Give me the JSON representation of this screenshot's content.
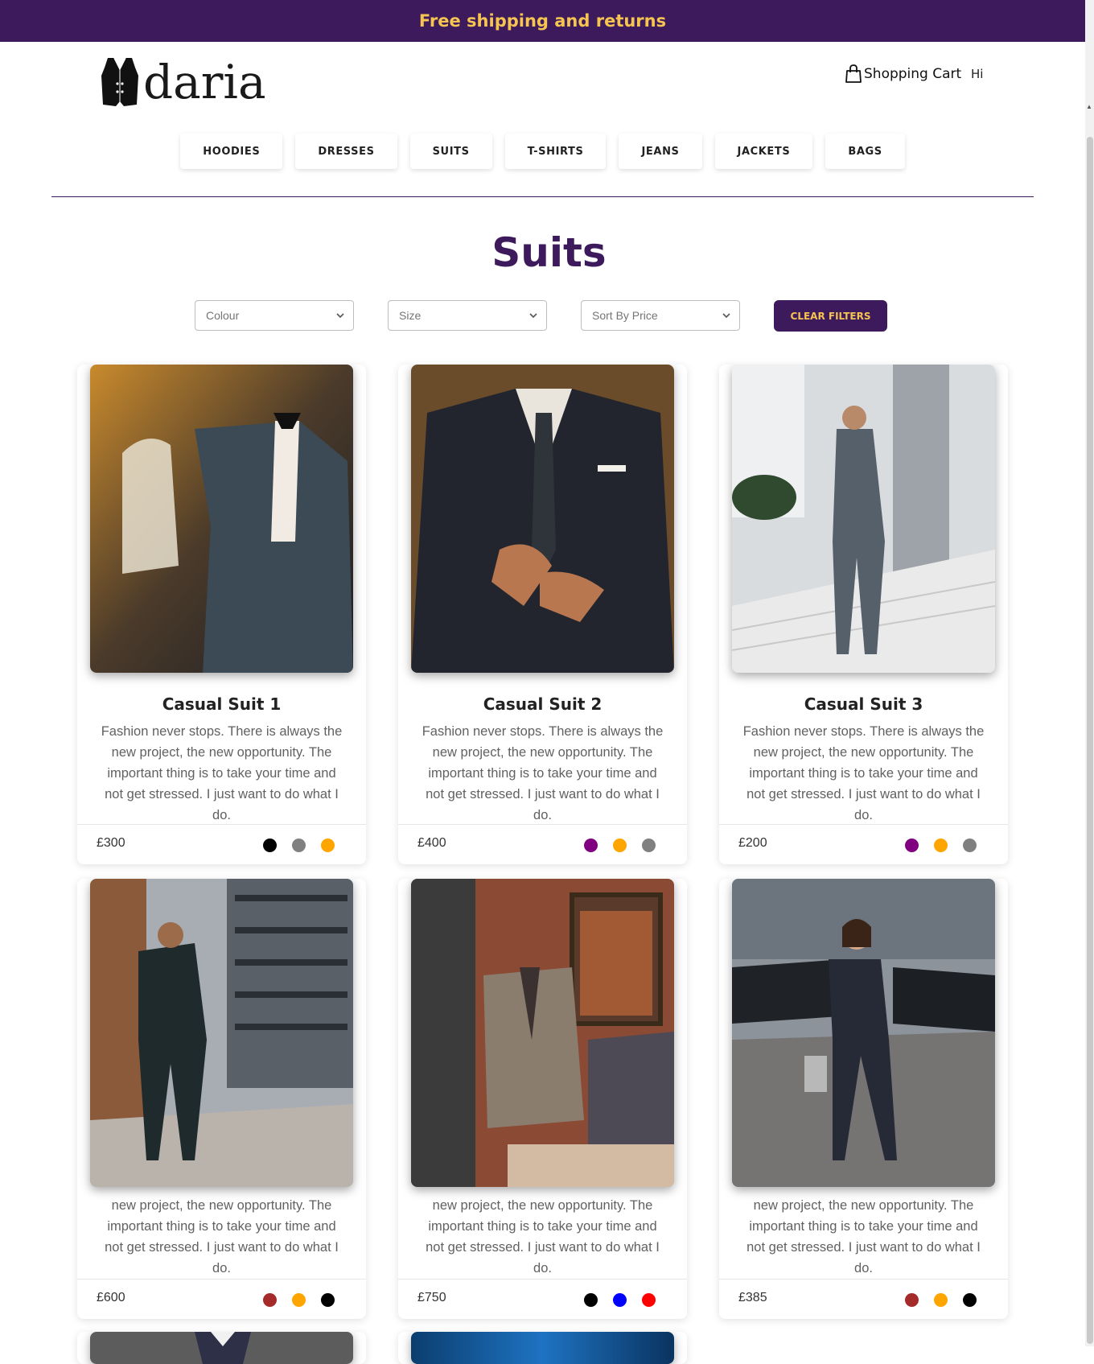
{
  "announcement": "Free shipping and returns",
  "brand": {
    "name": "daria"
  },
  "header": {
    "cart_label": "Shopping Cart",
    "greeting": "Hi"
  },
  "nav": {
    "items": [
      "HOODIES",
      "DRESSES",
      "SUITS",
      "T-SHIRTS",
      "JEANS",
      "JACKETS",
      "BAGS"
    ]
  },
  "page": {
    "title": "Suits"
  },
  "filters": {
    "colour_placeholder": "Colour",
    "size_placeholder": "Size",
    "sort_placeholder": "Sort By Price",
    "clear_label": "CLEAR FILTERS"
  },
  "products": [
    {
      "title": "Casual Suit 1",
      "description": "Fashion never stops. There is always the new project, the new opportunity. The important thing is to take your time and not get stressed. I just want to do what I do.",
      "price": "£300",
      "colors": [
        "#000000",
        "#808080",
        "#ffa500"
      ],
      "image": "suit-on-mannequin"
    },
    {
      "title": "Casual Suit 2",
      "description": "Fashion never stops. There is always the new project, the new opportunity. The important thing is to take your time and not get stressed. I just want to do what I do.",
      "price": "£400",
      "colors": [
        "#800080",
        "#ffa500",
        "#808080"
      ],
      "image": "man-buttoning-suit"
    },
    {
      "title": "Casual Suit 3",
      "description": "Fashion never stops. There is always the new project, the new opportunity. The important thing is to take your time and not get stressed. I just want to do what I do.",
      "price": "£200",
      "colors": [
        "#800080",
        "#ffa500",
        "#808080"
      ],
      "image": "man-on-stairs"
    },
    {
      "description_visible": "new project, the new opportunity. The important thing is to take your time and not get stressed. I just want to do what I do.",
      "price": "£600",
      "colors": [
        "#a52a2a",
        "#ffa500",
        "#000000"
      ],
      "image": "man-walking-street"
    },
    {
      "description_visible": "new project, the new opportunity. The important thing is to take your time and not get stressed. I just want to do what I do.",
      "price": "£750",
      "colors": [
        "#000000",
        "#0000ff",
        "#ff0000"
      ],
      "image": "suit-in-tailor-shop"
    },
    {
      "description_visible": "new project, the new opportunity. The important thing is to take your time and not get stressed. I just want to do what I do.",
      "price": "£385",
      "colors": [
        "#a52a2a",
        "#ffa500",
        "#000000"
      ],
      "image": "woman-in-suit"
    }
  ],
  "theme": {
    "primary": "#3d1a5b",
    "accent": "#f5c451"
  }
}
